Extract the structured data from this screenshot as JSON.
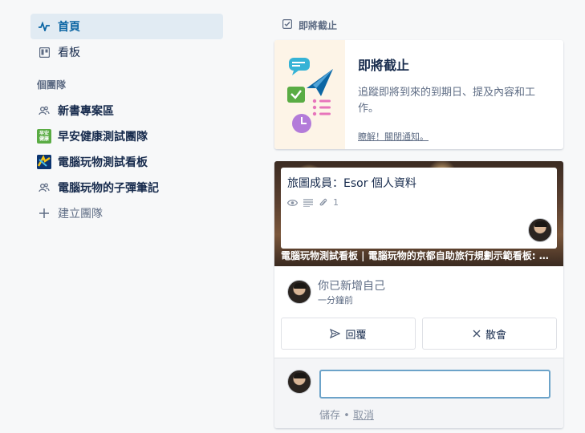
{
  "sidebar": {
    "nav": [
      {
        "label": "首頁",
        "icon": "activity-icon",
        "active": true
      },
      {
        "label": "看板",
        "icon": "board-icon",
        "active": false
      }
    ],
    "teams_title": "個團隊",
    "teams": [
      {
        "label": "新書專案區",
        "icon": "team-people-icon"
      },
      {
        "label": "早安健康測試團隊",
        "icon": "health-logo-icon"
      },
      {
        "label": "電腦玩物測試看板",
        "icon": "pc-logo-icon"
      },
      {
        "label": "電腦玩物的子彈筆記",
        "icon": "team-people-icon"
      }
    ],
    "create_label": "建立團隊"
  },
  "upcoming": {
    "header": "即將截止",
    "title": "即將截止",
    "desc": "追蹤即將到來的到期日、提及內容和工作。",
    "link": "瞭解！關閉通知。"
  },
  "activity": {
    "card_title": "旅圖成員：Esor 個人資料",
    "attachments": "1",
    "board_path": "電腦玩物測試看板 | 電腦玩物的京都自助旅行規劃示範看板: 旅...",
    "action_text": "你已新增自己",
    "time": "一分鐘前",
    "reply_label": "回覆",
    "dismiss_label": "散會",
    "comment_value": "",
    "save_label": "儲存",
    "separator": "•",
    "cancel_label": "取消"
  },
  "colors": {
    "active_bg": "#e1ebf3",
    "active_text": "#0c66a4",
    "input_border": "#6ca3c9"
  }
}
